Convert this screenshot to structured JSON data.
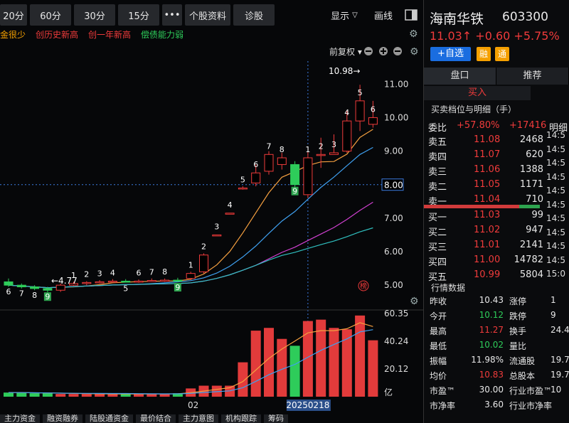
{
  "toolbar": {
    "periods": [
      "20分",
      "60分",
      "30分",
      "15分"
    ],
    "more": "•••",
    "profile": "个股资料",
    "diagnose": "诊股",
    "display": "显示",
    "draw": "画线"
  },
  "notice": [
    {
      "text": "金很少",
      "color": "#f5a000"
    },
    {
      "text": "创历史新高",
      "color": "#f03b3b"
    },
    {
      "text": "创一年新高",
      "color": "#f03b3b"
    },
    {
      "text": "偿债能力弱",
      "color": "#2ecc5a"
    }
  ],
  "chart": {
    "adjust": "前复权",
    "y_labels": [
      "11.00",
      "10.00",
      "9.00",
      "8.00",
      "7.00",
      "6.00",
      "5.00"
    ],
    "current_price_tag": "8.00",
    "high_label": "10.98→",
    "low_label": "←4.77",
    "vol_labels": [
      "60.35",
      "40.24",
      "20.12",
      "亿"
    ],
    "x_labels": [
      "02",
      "20250218"
    ],
    "badge": "榜"
  },
  "chart_data": {
    "type": "candlestick",
    "ylim": [
      4.6,
      11.6
    ],
    "candles": [
      {
        "o": 5.1,
        "c": 5.0,
        "h": 5.2,
        "l": 4.95,
        "n": "6"
      },
      {
        "o": 5.0,
        "c": 4.95,
        "h": 5.05,
        "l": 4.9,
        "n": "7"
      },
      {
        "o": 4.95,
        "c": 4.9,
        "h": 5.0,
        "l": 4.85,
        "n": "8"
      },
      {
        "o": 4.9,
        "c": 4.85,
        "h": 4.95,
        "l": 4.77,
        "n": "9"
      },
      {
        "o": 4.85,
        "c": 5.0,
        "h": 5.05,
        "l": 4.8,
        "n": ""
      },
      {
        "o": 5.0,
        "c": 5.05,
        "h": 5.1,
        "l": 4.98,
        "n": "1"
      },
      {
        "o": 5.05,
        "c": 5.08,
        "h": 5.12,
        "l": 5.0,
        "n": "2"
      },
      {
        "o": 5.08,
        "c": 5.1,
        "h": 5.15,
        "l": 5.05,
        "n": "3"
      },
      {
        "o": 5.1,
        "c": 5.12,
        "h": 5.18,
        "l": 5.08,
        "n": "4"
      },
      {
        "o": 5.12,
        "c": 5.1,
        "h": 5.18,
        "l": 5.08,
        "n": "5"
      },
      {
        "o": 5.1,
        "c": 5.12,
        "h": 5.17,
        "l": 5.07,
        "n": "6"
      },
      {
        "o": 5.12,
        "c": 5.14,
        "h": 5.2,
        "l": 5.1,
        "n": "7"
      },
      {
        "o": 5.14,
        "c": 5.15,
        "h": 5.2,
        "l": 5.1,
        "n": "8"
      },
      {
        "o": 5.15,
        "c": 5.13,
        "h": 5.22,
        "l": 5.1,
        "n": "9"
      },
      {
        "o": 5.2,
        "c": 5.35,
        "h": 5.4,
        "l": 5.15,
        "n": "1"
      },
      {
        "o": 5.4,
        "c": 5.9,
        "h": 5.95,
        "l": 5.35,
        "n": "2"
      },
      {
        "o": 6.5,
        "c": 6.5,
        "h": 6.5,
        "l": 6.5,
        "n": "3"
      },
      {
        "o": 7.15,
        "c": 7.15,
        "h": 7.15,
        "l": 7.15,
        "n": "4"
      },
      {
        "o": 7.9,
        "c": 7.9,
        "h": 7.95,
        "l": 7.85,
        "n": "5"
      },
      {
        "o": 8.05,
        "c": 8.35,
        "h": 8.6,
        "l": 7.95,
        "n": "6"
      },
      {
        "o": 8.4,
        "c": 8.9,
        "h": 9.0,
        "l": 8.3,
        "n": "7"
      },
      {
        "o": 8.6,
        "c": 8.8,
        "h": 8.95,
        "l": 8.45,
        "n": "8"
      },
      {
        "o": 8.6,
        "c": 8.0,
        "h": 8.7,
        "l": 7.7,
        "n": "9"
      },
      {
        "o": 7.7,
        "c": 8.8,
        "h": 9.0,
        "l": 7.6,
        "n": "1"
      },
      {
        "o": 8.9,
        "c": 8.9,
        "h": 9.4,
        "l": 8.5,
        "n": "2"
      },
      {
        "o": 8.9,
        "c": 8.95,
        "h": 9.5,
        "l": 8.9,
        "n": "3"
      },
      {
        "o": 9.0,
        "c": 9.9,
        "h": 10.2,
        "l": 8.95,
        "n": "4"
      },
      {
        "o": 9.9,
        "c": 10.5,
        "h": 10.98,
        "l": 9.6,
        "n": "5"
      },
      {
        "o": 9.8,
        "c": 10.0,
        "h": 10.5,
        "l": 9.7,
        "n": "6"
      }
    ],
    "volumes": [
      3,
      3,
      2.5,
      2.5,
      2,
      2,
      2,
      2,
      2,
      2,
      2,
      2,
      2,
      2.5,
      6,
      8,
      8,
      8,
      25,
      48,
      50,
      42,
      37,
      55,
      56,
      50,
      49,
      59,
      41
    ],
    "vol_ylim": [
      0,
      62
    ]
  },
  "stock": {
    "name": "海南华铁",
    "code": "603300",
    "price_line": "11.03↑ +0.60 +5.75%",
    "add_btn": "+自选",
    "rong": "融",
    "tong": "通"
  },
  "tabs": [
    "盘口",
    "推荐"
  ],
  "subtab": "买入",
  "ob_title": "买卖档位与明细（手）",
  "weibi": {
    "label": "委比",
    "pct": "+57.80%",
    "diff": "+17416",
    "extra": "明细"
  },
  "sells": [
    {
      "l": "卖五",
      "p": "11.08",
      "v": "2468"
    },
    {
      "l": "卖四",
      "p": "11.07",
      "v": "620"
    },
    {
      "l": "卖三",
      "p": "11.06",
      "v": "1388"
    },
    {
      "l": "卖二",
      "p": "11.05",
      "v": "1171"
    },
    {
      "l": "卖一",
      "p": "11.04",
      "v": "710"
    }
  ],
  "buys": [
    {
      "l": "买一",
      "p": "11.03",
      "v": "99"
    },
    {
      "l": "买二",
      "p": "11.02",
      "v": "947"
    },
    {
      "l": "买三",
      "p": "11.01",
      "v": "2141"
    },
    {
      "l": "买四",
      "p": "11.00",
      "v": "14782"
    },
    {
      "l": "买五",
      "p": "10.99",
      "v": "5804"
    }
  ],
  "times": [
    "14:5",
    "14:5",
    "14:5",
    "14:5",
    "14:5",
    "14:5",
    "14:5",
    "14:5",
    "14:5",
    "14:5",
    "15:0"
  ],
  "hq_title": "行情数据",
  "hq": [
    {
      "a": "昨收",
      "av": "10.43",
      "ac": "white",
      "b": "涨停",
      "bv": "1"
    },
    {
      "a": "今开",
      "av": "10.12",
      "ac": "green",
      "b": "跌停",
      "bv": "9"
    },
    {
      "a": "最高",
      "av": "11.27",
      "ac": "red",
      "b": "换手",
      "bv": "24.4"
    },
    {
      "a": "最低",
      "av": "10.02",
      "ac": "green",
      "b": "量比",
      "bv": ""
    },
    {
      "a": "振幅",
      "av": "11.98%",
      "ac": "white",
      "b": "流通股",
      "bv": "19.7"
    },
    {
      "a": "均价",
      "av": "10.83",
      "ac": "red",
      "b": "总股本",
      "bv": "19.7"
    },
    {
      "a": "市盈™",
      "av": "30.00",
      "ac": "white",
      "b": "行业市盈™",
      "bv": "10"
    },
    {
      "a": "市净率",
      "av": "3.60",
      "ac": "white",
      "b": "行业市净率",
      "bv": ""
    }
  ],
  "bottom_tabs": [
    "主力资金",
    "融资融券",
    "陆股通资金",
    "最价结合",
    "主力意图",
    "机构跟踪",
    "筹码"
  ]
}
